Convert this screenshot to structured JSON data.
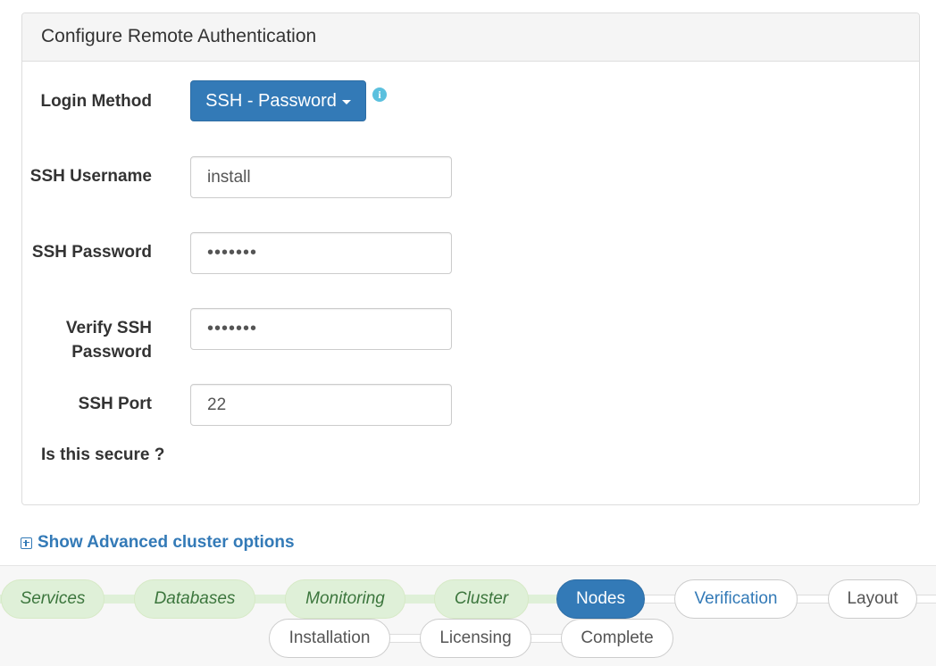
{
  "panel": {
    "title": "Configure Remote Authentication",
    "login_method": {
      "label": "Login Method",
      "value": "SSH - Password",
      "info_icon": "info-circle-icon"
    },
    "ssh_username": {
      "label": "SSH Username",
      "value": "install"
    },
    "ssh_password": {
      "label": "SSH Password",
      "value": "•••••••"
    },
    "verify_password": {
      "label": "Verify SSH Password",
      "value": "•••••••"
    },
    "ssh_port": {
      "label": "SSH Port",
      "value": "22"
    },
    "secure_label": "Is this secure ?"
  },
  "advanced": {
    "icon": "plus-square-icon",
    "label": "Show Advanced cluster options"
  },
  "wizard": {
    "steps": [
      {
        "label": "Services",
        "state": "done"
      },
      {
        "label": "Databases",
        "state": "done"
      },
      {
        "label": "Monitoring",
        "state": "done"
      },
      {
        "label": "Cluster",
        "state": "done"
      },
      {
        "label": "Nodes",
        "state": "active"
      },
      {
        "label": "Verification",
        "state": "next"
      },
      {
        "label": "Layout",
        "state": "todo"
      },
      {
        "label": "Installation",
        "state": "todo"
      },
      {
        "label": "Licensing",
        "state": "todo"
      },
      {
        "label": "Complete",
        "state": "todo"
      }
    ]
  },
  "colors": {
    "primary": "#337ab7",
    "done_bg": "#dff0d8",
    "done_text": "#3c763d",
    "info": "#5bc0de"
  }
}
